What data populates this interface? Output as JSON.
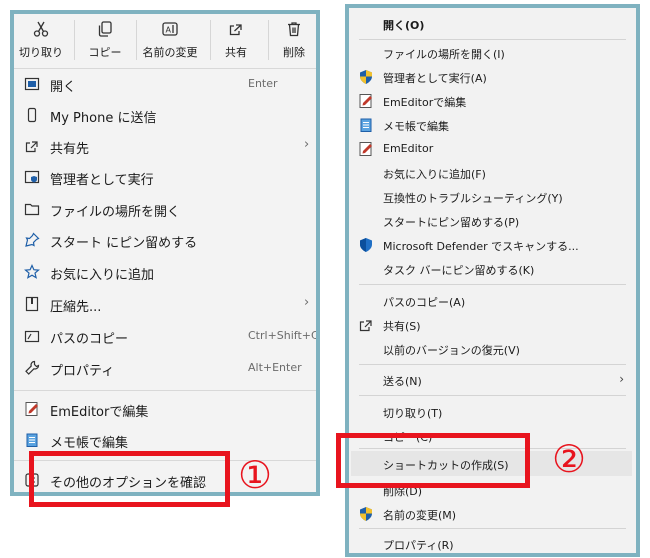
{
  "colors": {
    "frame": "#7fb2c0",
    "highlight": "#e8141e",
    "menu_bg": "#f3f3f3"
  },
  "left": {
    "toolbar": [
      {
        "label": "切り取り",
        "icon": "scissors-icon"
      },
      {
        "label": "コピー",
        "icon": "copy-icon"
      },
      {
        "label": "名前の変更",
        "icon": "rename-icon"
      },
      {
        "label": "共有",
        "icon": "share-icon"
      },
      {
        "label": "削除",
        "icon": "trash-icon"
      }
    ],
    "items": [
      {
        "label": "開く",
        "shortcut": "Enter",
        "icon": "open-window-icon"
      },
      {
        "label": "My Phone に送信",
        "icon": "phone-icon"
      },
      {
        "label": "共有先",
        "icon": "share-icon",
        "submenu": true
      },
      {
        "label": "管理者として実行",
        "icon": "admin-shield-icon"
      },
      {
        "label": "ファイルの場所を開く",
        "icon": "folder-icon"
      },
      {
        "label": "スタート にピン留めする",
        "icon": "pin-icon"
      },
      {
        "label": "お気に入りに追加",
        "icon": "star-icon"
      },
      {
        "label": "圧縮先...",
        "icon": "zip-icon",
        "submenu": true
      },
      {
        "label": "パスのコピー",
        "shortcut": "Ctrl+Shift+C",
        "icon": "path-copy-icon"
      },
      {
        "label": "プロパティ",
        "shortcut": "Alt+Enter",
        "icon": "wrench-icon"
      },
      {
        "label": "EmEditorで編集",
        "icon": "emeditor-icon"
      },
      {
        "label": "メモ帳で編集",
        "icon": "notepad-icon"
      },
      {
        "label": "その他のオプションを確認",
        "icon": "more-options-icon"
      }
    ],
    "marker": "①"
  },
  "right": {
    "items": [
      {
        "label": "開く(O)",
        "icon": ""
      },
      {
        "label": "ファイルの場所を開く(I)",
        "icon": ""
      },
      {
        "label": "管理者として実行(A)",
        "icon": "admin-shield-icon"
      },
      {
        "label": "EmEditorで編集",
        "icon": "emeditor-icon"
      },
      {
        "label": "メモ帳で編集",
        "icon": "notepad-icon"
      },
      {
        "label": "EmEditor",
        "icon": "emeditor-icon"
      },
      {
        "label": "お気に入りに追加(F)",
        "icon": ""
      },
      {
        "label": "互換性のトラブルシューティング(Y)",
        "icon": ""
      },
      {
        "label": "スタートにピン留めする(P)",
        "icon": ""
      },
      {
        "label": "Microsoft Defender でスキャンする...",
        "icon": "defender-icon"
      },
      {
        "label": "タスク バーにピン留めする(K)",
        "icon": ""
      },
      {
        "label": "パスのコピー(A)",
        "icon": ""
      },
      {
        "label": "共有(S)",
        "icon": "share-icon"
      },
      {
        "label": "以前のバージョンの復元(V)",
        "icon": ""
      },
      {
        "label": "送る(N)",
        "icon": "",
        "submenu": true
      },
      {
        "label": "切り取り(T)",
        "icon": ""
      },
      {
        "label": "コピー(C)",
        "icon": ""
      },
      {
        "label": "ショートカットの作成(S)",
        "icon": ""
      },
      {
        "label": "削除(D)",
        "icon": ""
      },
      {
        "label": "名前の変更(M)",
        "icon": "admin-shield-icon"
      },
      {
        "label": "プロパティ(R)",
        "icon": ""
      }
    ],
    "marker": "②"
  }
}
